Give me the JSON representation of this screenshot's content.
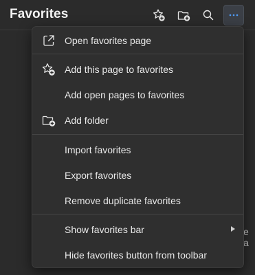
{
  "header": {
    "title": "Favorites",
    "buttons": [
      {
        "icon": "add-to-favorites-icon"
      },
      {
        "icon": "add-folder-icon"
      },
      {
        "icon": "search-icon"
      },
      {
        "icon": "more-options-icon"
      }
    ]
  },
  "background": {
    "partial_text": "e a"
  },
  "menu": {
    "items": [
      {
        "label": "Open favorites page",
        "icon": "open-external-icon"
      },
      {
        "label": "Add this page to favorites",
        "icon": "star-add-icon"
      },
      {
        "label": "Add open pages to favorites"
      },
      {
        "label": "Add folder",
        "icon": "folder-add-icon"
      },
      {
        "label": "Import favorites"
      },
      {
        "label": "Export favorites"
      },
      {
        "label": "Remove duplicate favorites"
      },
      {
        "label": "Show favorites bar",
        "submenu": true
      },
      {
        "label": "Hide favorites button from toolbar"
      }
    ]
  },
  "colors": {
    "background": "#2b2b2b",
    "menu_background": "#2f2f2f",
    "accent": "#4f9cf7"
  }
}
